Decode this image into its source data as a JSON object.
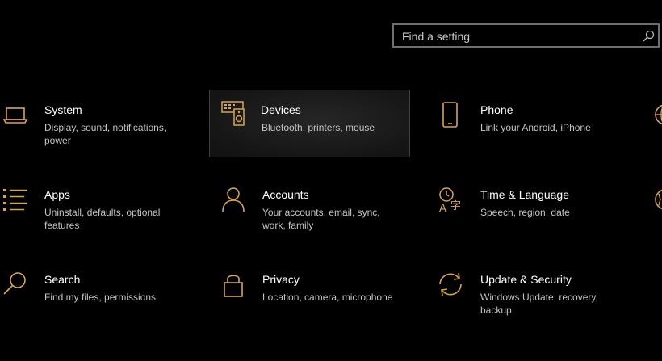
{
  "accent_color": "#d7a54a",
  "search": {
    "placeholder": "Find a setting",
    "icon": "search-icon"
  },
  "categories": [
    {
      "title": "System",
      "description": "Display, sound, notifications, power",
      "icon": "laptop-icon"
    },
    {
      "title": "Devices",
      "description": "Bluetooth, printers, mouse",
      "icon": "devices-icon",
      "state": "hovered"
    },
    {
      "title": "Phone",
      "description": "Link your Android, iPhone",
      "icon": "phone-icon"
    },
    {
      "title": "Apps",
      "description": "Uninstall, defaults, optional features",
      "icon": "apps-list-icon"
    },
    {
      "title": "Accounts",
      "description": "Your accounts, email, sync, work, family",
      "icon": "person-icon"
    },
    {
      "title": "Time & Language",
      "description": "Speech, region, date",
      "icon": "time-language-icon"
    },
    {
      "title": "Search",
      "description": "Find my files, permissions",
      "icon": "magnifier-icon"
    },
    {
      "title": "Privacy",
      "description": "Location, camera, microphone",
      "icon": "lock-icon"
    },
    {
      "title": "Update & Security",
      "description": "Windows Update, recovery, backup",
      "icon": "sync-arrows-icon"
    }
  ],
  "partial_icons": [
    "globe-icon",
    "gaming-icon"
  ]
}
